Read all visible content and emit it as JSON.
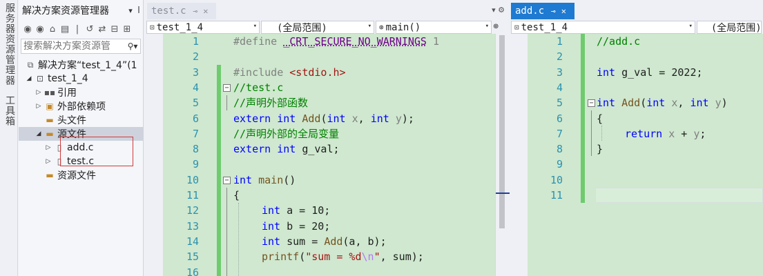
{
  "side_tabs": [
    "服务器资源管理器",
    "工具箱"
  ],
  "solution_explorer": {
    "title": "解决方案资源管理器",
    "search_placeholder": "搜索解决方案资源管",
    "tree": [
      {
        "label": "解决方案“test_1_4”(1",
        "icon": "solution-icon"
      },
      {
        "label": "test_1_4",
        "icon": "project-icon"
      },
      {
        "label": "引用",
        "icon": "references-icon"
      },
      {
        "label": "外部依赖项",
        "icon": "external-deps-icon"
      },
      {
        "label": "头文件",
        "icon": "folder-icon"
      },
      {
        "label": "源文件",
        "icon": "folder-icon"
      },
      {
        "label": "add.c",
        "icon": "c-file-icon"
      },
      {
        "label": "test.c",
        "icon": "c-file-icon"
      },
      {
        "label": "资源文件",
        "icon": "folder-icon"
      }
    ]
  },
  "editor_left": {
    "tab_label": "test.c",
    "project_dropdown": "test_1_4",
    "scope_dropdown": "(全局范围)",
    "member_dropdown": "main()",
    "line_numbers": [
      "1",
      "2",
      "3",
      "4",
      "5",
      "6",
      "7",
      "8",
      "9",
      "10",
      "11",
      "12",
      "13",
      "14",
      "15",
      "16"
    ]
  },
  "editor_right": {
    "tab_label": "add.c",
    "project_dropdown": "test_1_4",
    "scope_dropdown": "(全局范围)",
    "line_numbers": [
      "1",
      "2",
      "3",
      "4",
      "5",
      "6",
      "7",
      "8",
      "9",
      "10",
      "11"
    ]
  },
  "colors": {
    "editor_bg": "#cfe8cf",
    "keyword": "#0000ff",
    "comment": "#008000",
    "line_number": "#2b91af",
    "active_tab": "#1f7ad1"
  }
}
